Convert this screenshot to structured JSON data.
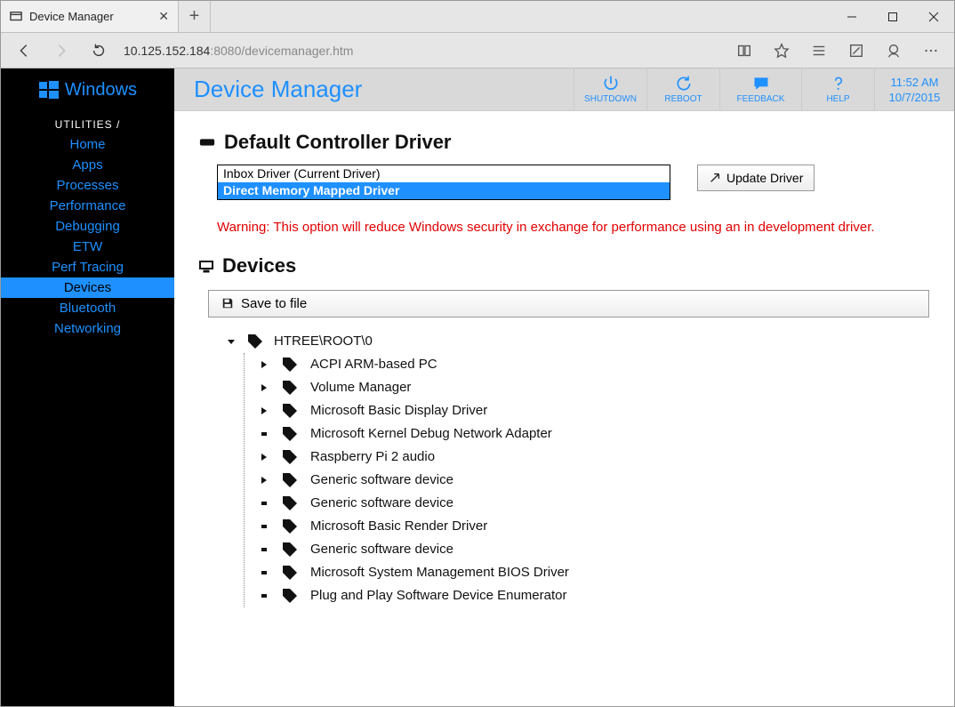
{
  "browser": {
    "tab_title": "Device Manager",
    "url_host": "10.125.152.184",
    "url_port": ":8080",
    "url_path": "/devicemanager.htm"
  },
  "sidebar": {
    "brand": "Windows",
    "caption": "UTILITIES /",
    "items": [
      {
        "label": "Home"
      },
      {
        "label": "Apps"
      },
      {
        "label": "Processes"
      },
      {
        "label": "Performance"
      },
      {
        "label": "Debugging"
      },
      {
        "label": "ETW"
      },
      {
        "label": "Perf Tracing"
      },
      {
        "label": "Devices"
      },
      {
        "label": "Bluetooth"
      },
      {
        "label": "Networking"
      }
    ],
    "active_index": 7
  },
  "topbar": {
    "title": "Device Manager",
    "actions": [
      {
        "label": "SHUTDOWN",
        "icon": "power-icon"
      },
      {
        "label": "REBOOT",
        "icon": "refresh-icon"
      },
      {
        "label": "FEEDBACK",
        "icon": "chat-icon"
      },
      {
        "label": "HELP",
        "icon": "help-icon"
      }
    ],
    "time": "11:52 AM",
    "date": "10/7/2015"
  },
  "driver_section": {
    "title": "Default Controller Driver",
    "options": [
      "Inbox Driver (Current Driver)",
      "Direct Memory Mapped Driver"
    ],
    "selected_index": 1,
    "update_button": "Update Driver",
    "warning": "Warning: This option will reduce Windows security in exchange for performance using an in development driver."
  },
  "devices_section": {
    "title": "Devices",
    "save_button": "Save to file",
    "root": "HTREE\\ROOT\\0",
    "children": [
      {
        "label": "ACPI ARM-based PC",
        "expandable": true
      },
      {
        "label": "Volume Manager",
        "expandable": true
      },
      {
        "label": "Microsoft Basic Display Driver",
        "expandable": true
      },
      {
        "label": "Microsoft Kernel Debug Network Adapter",
        "expandable": false
      },
      {
        "label": "Raspberry Pi 2 audio",
        "expandable": true
      },
      {
        "label": "Generic software device",
        "expandable": true
      },
      {
        "label": "Generic software device",
        "expandable": false
      },
      {
        "label": "Microsoft Basic Render Driver",
        "expandable": false
      },
      {
        "label": "Generic software device",
        "expandable": false
      },
      {
        "label": "Microsoft System Management BIOS Driver",
        "expandable": false
      },
      {
        "label": "Plug and Play Software Device Enumerator",
        "expandable": false
      }
    ]
  }
}
